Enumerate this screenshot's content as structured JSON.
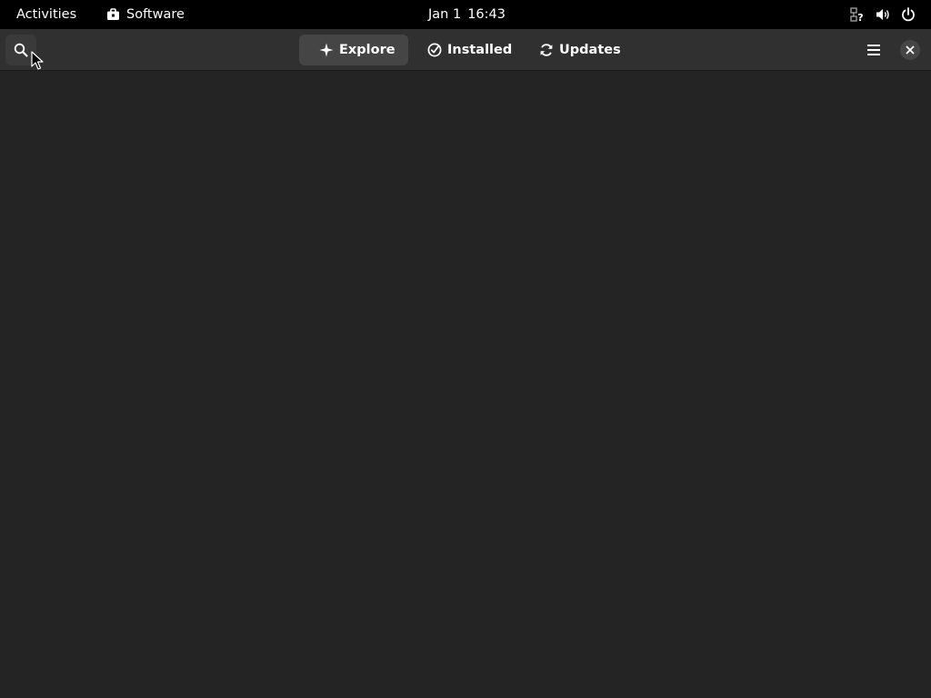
{
  "topbar": {
    "activities_label": "Activities",
    "app_name": "Software",
    "clock": {
      "date": "Jan 1",
      "time": "16:43"
    },
    "tray_icons": [
      "network-unknown-icon",
      "volume-icon",
      "power-icon"
    ]
  },
  "headerbar": {
    "search_icon": "search-icon",
    "tabs": [
      {
        "label": "Explore",
        "icon": "explore-icon",
        "selected": true
      },
      {
        "label": "Installed",
        "icon": "installed-check-icon",
        "selected": false
      },
      {
        "label": "Updates",
        "icon": "refresh-icon",
        "selected": false
      }
    ],
    "menu_icon": "hamburger-menu-icon",
    "close_icon": "close-icon"
  },
  "colors": {
    "topbar_bg": "#000000",
    "headerbar_bg": "#303030",
    "content_bg": "#242424",
    "selected_tab_bg": "#454545"
  }
}
